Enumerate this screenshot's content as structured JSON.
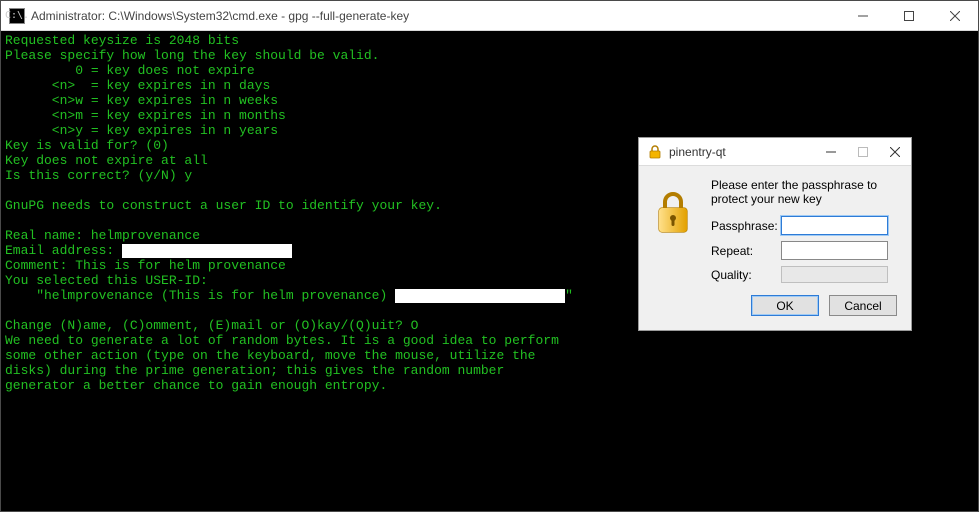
{
  "cmd": {
    "icon_label": "C:\\.",
    "title": "Administrator: C:\\Windows\\System32\\cmd.exe - gpg  --full-generate-key",
    "lines": {
      "l0": "Requested keysize is 2048 bits",
      "l1": "Please specify how long the key should be valid.",
      "l2": "         0 = key does not expire",
      "l3": "      <n>  = key expires in n days",
      "l4": "      <n>w = key expires in n weeks",
      "l5": "      <n>m = key expires in n months",
      "l6": "      <n>y = key expires in n years",
      "l7": "Key is valid for? (0)",
      "l8": "Key does not expire at all",
      "l9": "Is this correct? (y/N) y",
      "l10": "",
      "l11": "GnuPG needs to construct a user ID to identify your key.",
      "l12": "",
      "l13a": "Real name: helmprovenance",
      "l14a": "Email address: ",
      "l15": "Comment: This is for helm provenance",
      "l16": "You selected this USER-ID:",
      "l17a": "    \"helmprovenance (This is for helm provenance) ",
      "l17b": "\"",
      "l18": "",
      "l19": "Change (N)ame, (C)omment, (E)mail or (O)kay/(Q)uit? O",
      "l20": "We need to generate a lot of random bytes. It is a good idea to perform",
      "l21": "some other action (type on the keyboard, move the mouse, utilize the",
      "l22": "disks) during the prime generation; this gives the random number",
      "l23": "generator a better chance to gain enough entropy."
    }
  },
  "pinentry": {
    "title": "pinentry-qt",
    "instruction": "Please enter the passphrase to protect your new key",
    "labels": {
      "passphrase": "Passphrase:",
      "repeat": "Repeat:",
      "quality": "Quality:"
    },
    "values": {
      "passphrase": "",
      "repeat": ""
    },
    "buttons": {
      "ok": "OK",
      "cancel": "Cancel"
    }
  }
}
